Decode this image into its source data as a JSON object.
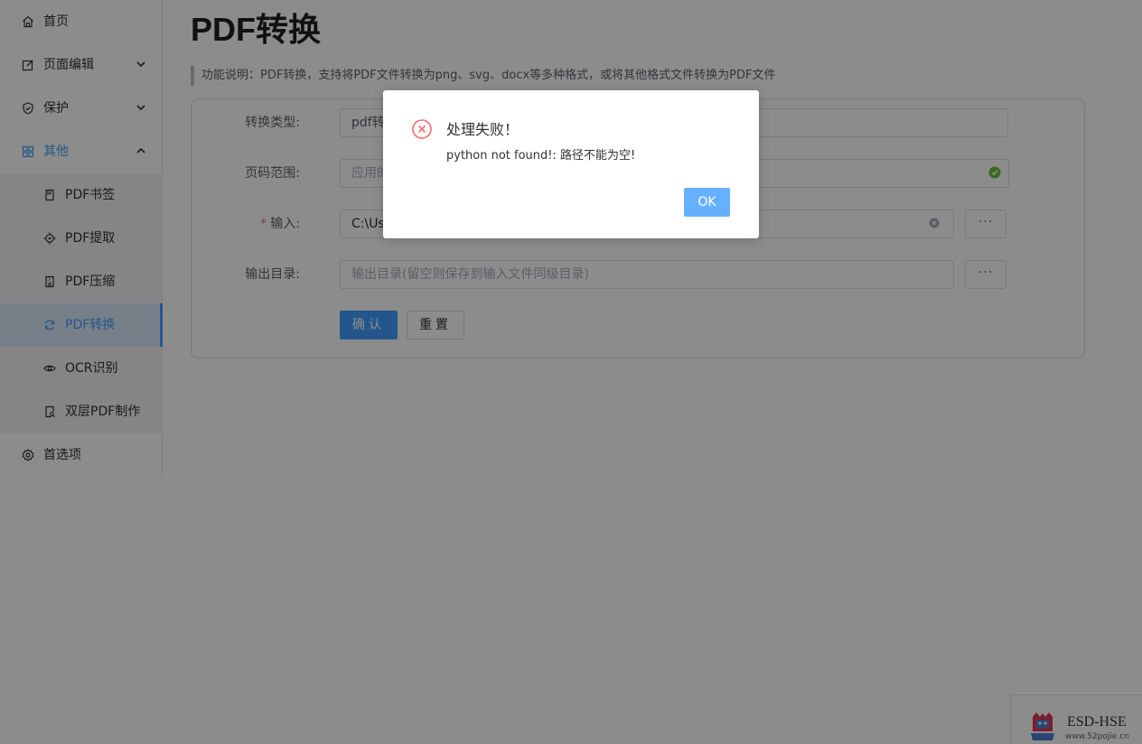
{
  "sidebar": {
    "items": [
      {
        "label": "首页",
        "icon": "home-icon"
      },
      {
        "label": "页面编辑",
        "icon": "edit-icon"
      },
      {
        "label": "保护",
        "icon": "shield-icon"
      },
      {
        "label": "其他",
        "icon": "grid-icon"
      },
      {
        "label": "首选项",
        "icon": "gear-icon"
      }
    ],
    "sub_items": [
      {
        "label": "PDF书签",
        "icon": "bookmark-icon"
      },
      {
        "label": "PDF提取",
        "icon": "target-icon"
      },
      {
        "label": "PDF压缩",
        "icon": "compress-icon"
      },
      {
        "label": "PDF转换",
        "icon": "refresh-icon"
      },
      {
        "label": "OCR识别",
        "icon": "eye-icon"
      },
      {
        "label": "双层PDF制作",
        "icon": "search-doc-icon"
      }
    ],
    "active_color": "#409eff"
  },
  "main": {
    "title": "PDF转换",
    "description": "功能说明：PDF转换，支持将PDF文件转换为png、svg、docx等多种格式，或将其他格式文件转换为PDF文件",
    "form": {
      "type_label": "转换类型:",
      "type_value": "pdf转",
      "range_label": "页码范围:",
      "range_placeholder": "应用的",
      "input_label": "输入:",
      "input_required": "*",
      "input_value": "C:\\Use",
      "output_label": "输出目录:",
      "output_placeholder": "输出目录(留空则保存到输入文件同级目录)",
      "browse_label": "···",
      "confirm_label": "确认",
      "reset_label": "重置"
    }
  },
  "dialog": {
    "title": "处理失败！",
    "message": "python not found!: 路径不能为空!",
    "ok_label": "OK",
    "error_color": "#f56c6c"
  },
  "watermark": {
    "text": "ESD-HSE",
    "sub": "www.52pojie.cn"
  }
}
